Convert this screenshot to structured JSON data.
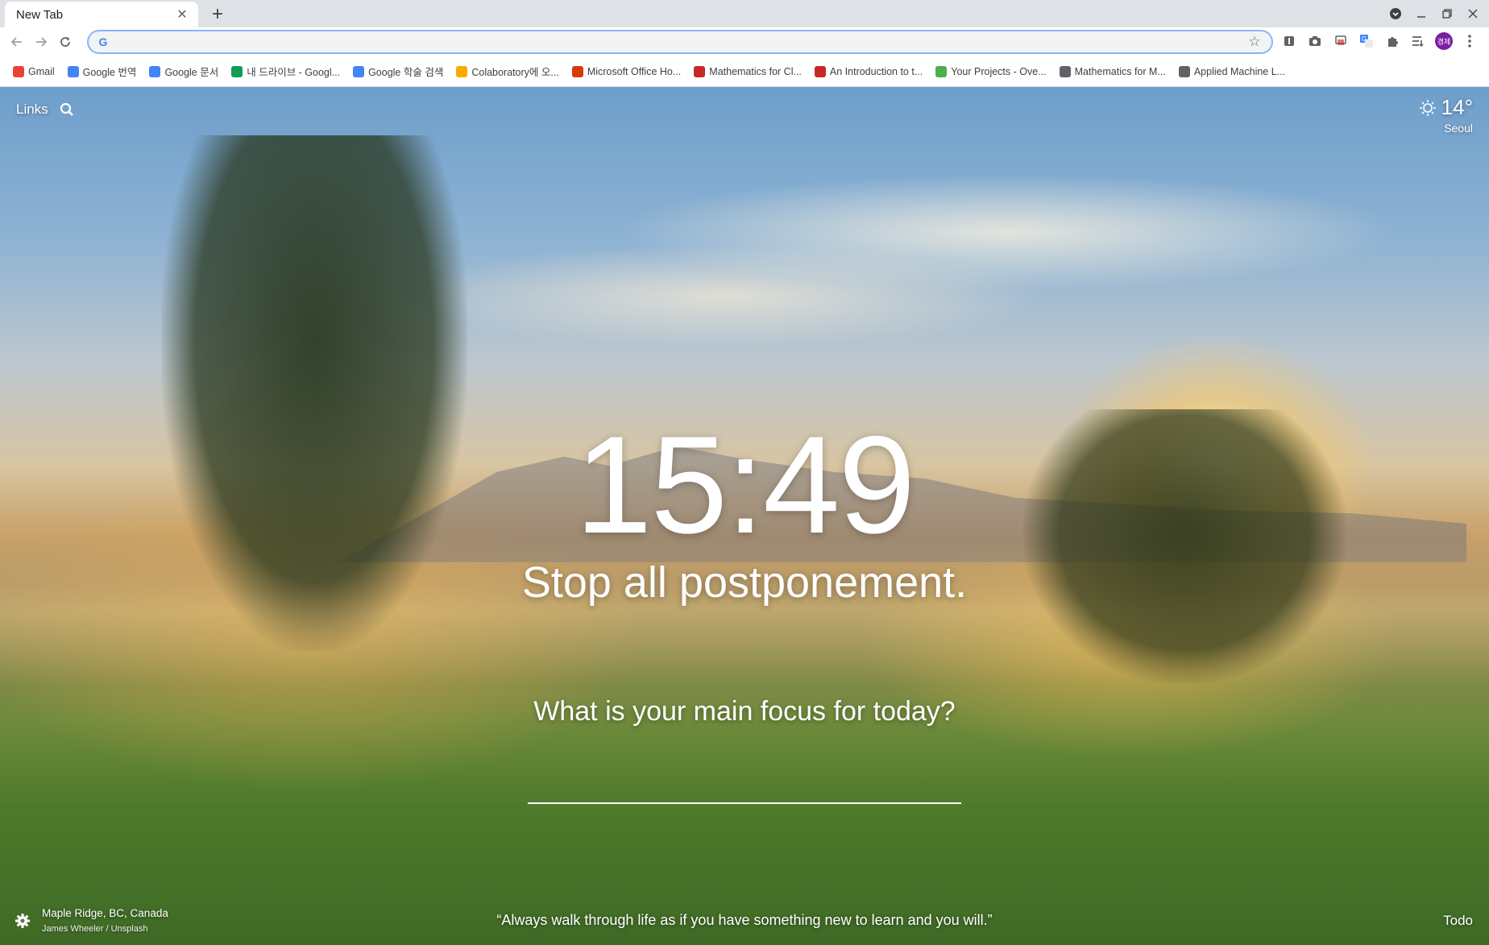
{
  "browser": {
    "tab": {
      "title": "New Tab",
      "close_icon": "close-icon"
    },
    "new_tab_icon": "plus-icon",
    "window_controls": [
      "tab-search-icon",
      "minimize-icon",
      "restore-icon",
      "close-window-icon"
    ],
    "address_bar": {
      "value": "",
      "placeholder": ""
    },
    "profile_initials": "경제"
  },
  "bookmarks": [
    {
      "label": "Gmail",
      "color": "#ea4335",
      "icon": "gmail-icon"
    },
    {
      "label": "Google 번역",
      "color": "#4285f4",
      "icon": "translate-icon"
    },
    {
      "label": "Google 문서",
      "color": "#4285f4",
      "icon": "docs-icon"
    },
    {
      "label": "내 드라이브 - Googl...",
      "color": "#0f9d58",
      "icon": "drive-icon"
    },
    {
      "label": "Google 학술 검색",
      "color": "#4285f4",
      "icon": "scholar-icon"
    },
    {
      "label": "Colaboratory에 오...",
      "color": "#f9ab00",
      "icon": "colab-icon"
    },
    {
      "label": "Microsoft Office Ho...",
      "color": "#d83b01",
      "icon": "office-icon"
    },
    {
      "label": "Mathematics for Cl...",
      "color": "#c62828",
      "icon": "bookmark-n-icon"
    },
    {
      "label": "An Introduction to t...",
      "color": "#c62828",
      "icon": "bookmark-m-icon"
    },
    {
      "label": "Your Projects - Ove...",
      "color": "#4caf50",
      "icon": "overleaf-icon"
    },
    {
      "label": "Mathematics for M...",
      "color": "#5f6368",
      "icon": "globe-icon"
    },
    {
      "label": "Applied Machine L...",
      "color": "#5f6368",
      "icon": "globe-icon"
    }
  ],
  "dashboard": {
    "links_label": "Links",
    "weather": {
      "temp": "14°",
      "city": "Seoul"
    },
    "time": "15:49",
    "mantra": "Stop all postponement.",
    "focus_question": "What is your main focus for today?",
    "photo": {
      "location": "Maple Ridge, BC, Canada",
      "credit": "James Wheeler / Unsplash"
    },
    "quote": "“Always walk through life as if you have something new to learn and you will.”",
    "todo_label": "Todo"
  }
}
